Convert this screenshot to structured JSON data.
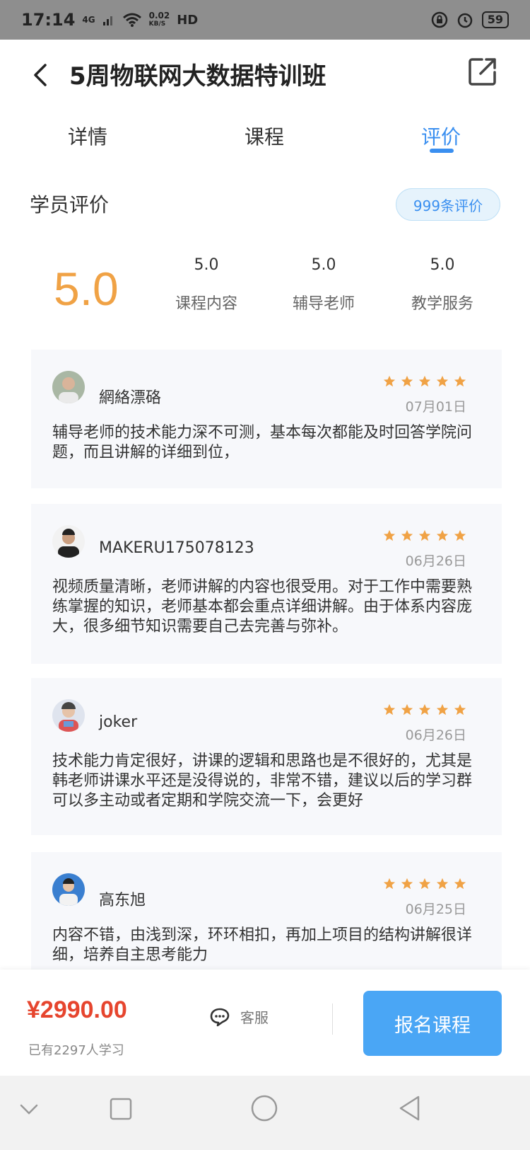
{
  "status_bar": {
    "time": "17:14",
    "network": "4G",
    "speed_value": "0.02",
    "speed_unit": "KB/S",
    "hd": "HD",
    "battery": "59"
  },
  "header": {
    "title": "5周物联网大数据特训班"
  },
  "tabs": [
    {
      "label": "详情",
      "active": false
    },
    {
      "label": "课程",
      "active": false
    },
    {
      "label": "评价",
      "active": true
    }
  ],
  "reviews_section": {
    "title": "学员评价",
    "count_badge": "999条评价",
    "overall_score": "5.0",
    "sub_scores": [
      {
        "value": "5.0",
        "label": "课程内容"
      },
      {
        "value": "5.0",
        "label": "辅导老师"
      },
      {
        "value": "5.0",
        "label": "教学服务"
      }
    ]
  },
  "reviews": [
    {
      "name": "網絡漂硌",
      "stars": 5,
      "date": "07月01日",
      "text": "辅导老师的技术能力深不可测，基本每次都能及时回答学院问题，而且讲解的详细到位，"
    },
    {
      "name": "MAKERU175078123",
      "stars": 5,
      "date": "06月26日",
      "text": "视频质量清晰，老师讲解的内容也很受用。对于工作中需要熟练掌握的知识，老师基本都会重点详细讲解。由于体系内容庞大，很多细节知识需要自己去完善与弥补。"
    },
    {
      "name": "joker",
      "stars": 5,
      "date": "06月26日",
      "text": "技术能力肯定很好，讲课的逻辑和思路也是不很好的，尤其是韩老师讲课水平还是没得说的，非常不错，建议以后的学习群可以多主动或者定期和学院交流一下，会更好"
    },
    {
      "name": "高东旭",
      "stars": 5,
      "date": "06月25日",
      "text": "内容不错，由浅到深，环环相扣，再加上项目的结构讲解很详细，培养自主思考能力"
    }
  ],
  "bottom_bar": {
    "price": "¥2990.00",
    "learners": "已有2297人学习",
    "service_label": "客服",
    "enroll_label": "报名课程"
  },
  "colors": {
    "accent": "#3a8ff0",
    "score": "#f0a245",
    "price": "#e6452e",
    "button": "#4aa6f5"
  }
}
